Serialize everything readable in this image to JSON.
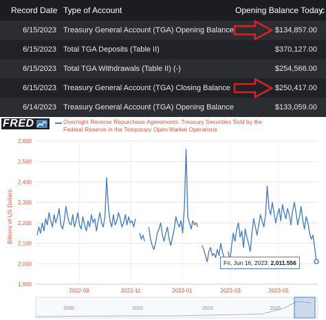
{
  "table": {
    "headers": {
      "record_date": "Record Date",
      "type": "Type of Account",
      "balance": "Opening Balance Today",
      "cut": "c"
    },
    "rows": [
      {
        "date": "6/15/2023",
        "type": "Treasury General Account (TGA) Opening Balance",
        "balance": "$134,857.00",
        "arrow": true
      },
      {
        "date": "6/15/2023",
        "type": "Total TGA Deposits (Table II)",
        "balance": "$370,127.00",
        "arrow": false
      },
      {
        "date": "6/15/2023",
        "type": "Total TGA Withdrawals (Table II) (-)",
        "balance": "$254,566.00",
        "arrow": false
      },
      {
        "date": "6/15/2023",
        "type": "Treasury General Account (TGA) Closing Balance",
        "balance": "$250,417.00",
        "arrow": true
      },
      {
        "date": "6/14/2023",
        "type": "Treasury General Account (TGA) Opening Balance",
        "balance": "$133,059.00",
        "arrow": false
      }
    ],
    "arrow_color": "#e02020"
  },
  "fred": {
    "logo": "FRED",
    "legend": "Overnight Reverse Repurchase Agreements: Treasury Securities Sold by the Federal Reserve in the Temporary Open Market Operations",
    "ylabel": "Billions of US Dollars",
    "tooltip_date": "Fri, Jun 16, 2023:",
    "tooltip_value": "2,011.556",
    "series_color": "#4a7fbc",
    "label_color": "#e8543c"
  },
  "chart_data": {
    "type": "line",
    "title": "",
    "xlabel": "",
    "ylabel": "Billions of US Dollars",
    "ylim": [
      1900,
      2600
    ],
    "yticks": [
      1900,
      2000,
      2100,
      2200,
      2300,
      2400,
      2500,
      2600
    ],
    "ytick_labels": [
      "1,900",
      "2,000",
      "2,100",
      "2,200",
      "2,300",
      "2,400",
      "2,500",
      "2,600"
    ],
    "xticks": [
      "2022-09",
      "2022-11",
      "2023-01",
      "2023-03",
      "2023-05"
    ],
    "grid": true,
    "series": [
      {
        "name": "Overnight Reverse Repurchase Agreements: Treasury Securities Sold by the Federal Reserve in the Temporary Open Market Operations",
        "segments": [
          [
            2140,
            2180,
            2150,
            2200,
            2160,
            2220,
            2190,
            2250,
            2210,
            2180,
            2240,
            2200,
            2230,
            2270,
            2190,
            2170,
            2210,
            2280,
            2230,
            2200,
            2190,
            2240,
            2180,
            2210,
            2250,
            2190,
            2170,
            2230,
            2190,
            2160,
            2210,
            2180,
            2240,
            2200,
            2220,
            2160,
            2210,
            2250,
            2200,
            2180,
            2230,
            2420,
            2280,
            2210,
            2180,
            2240,
            2190,
            2210,
            2250,
            2220,
            2180,
            2200,
            2240,
            2190,
            2230,
            2200,
            2210,
            2180,
            2220
          ],
          [
            2150,
            2120,
            2140,
            2110
          ],
          [
            2180,
            2120,
            2090,
            2070,
            2100,
            2150,
            2170,
            2200,
            2140,
            2110,
            2150,
            2180,
            2120,
            2090,
            2130,
            2170,
            2230,
            2200,
            2180,
            2210,
            2150,
            2280,
            2560,
            2230,
            2200,
            2170,
            2210,
            2190,
            2200,
            2180
          ],
          [
            2090,
            2070,
            2040,
            2010,
            2060,
            2080,
            2040,
            2050,
            2030,
            2070,
            2040,
            2100,
            2060,
            2030
          ],
          [
            2060,
            2010,
            2090,
            2150,
            2110,
            2170,
            2200,
            2130,
            2160,
            2080,
            2170,
            2130,
            2100,
            2060,
            2150,
            2220,
            2180,
            2140,
            2190,
            2240,
            2210,
            2180,
            2240,
            2380,
            2270,
            2240,
            2300,
            2250,
            2200,
            2240,
            2270,
            2210,
            2290,
            2250,
            2220,
            2270,
            2240,
            2190,
            2260,
            2300,
            2250,
            2190,
            2230,
            2280,
            2210,
            2170,
            2230,
            2200,
            2150,
            2120,
            2140,
            2080,
            2011
          ]
        ]
      }
    ],
    "annotation": {
      "label": "Fri, Jun 16, 2023",
      "value": 2011.556
    },
    "navigator": {
      "ticks": [
        "2005",
        "2010",
        "2015",
        "2020"
      ]
    }
  }
}
